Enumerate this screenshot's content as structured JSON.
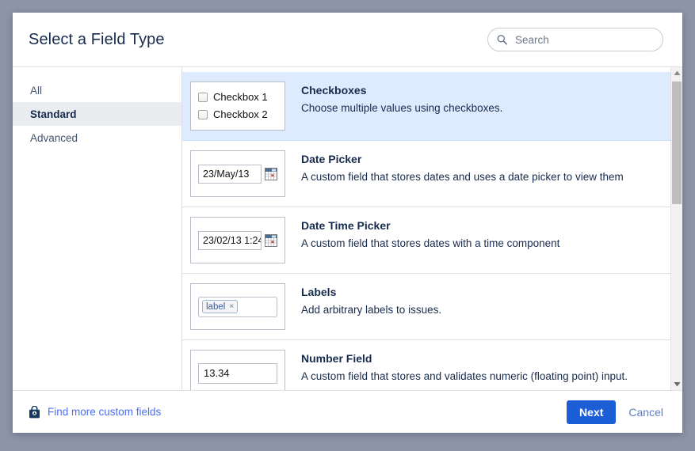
{
  "dialog": {
    "title": "Select a Field Type"
  },
  "search": {
    "placeholder": "Search",
    "value": "",
    "icon": "search-icon"
  },
  "sidebar": {
    "items": [
      {
        "label": "All",
        "selected": false
      },
      {
        "label": "Standard",
        "selected": true
      },
      {
        "label": "Advanced",
        "selected": false
      }
    ]
  },
  "fields": [
    {
      "name": "Checkboxes",
      "description": "Choose multiple values using checkboxes.",
      "selected": true,
      "preview_type": "checkboxes",
      "preview": {
        "option1": "Checkbox 1",
        "option2": "Checkbox 2"
      }
    },
    {
      "name": "Date Picker",
      "description": "A custom field that stores dates and uses a date picker to view them",
      "selected": false,
      "preview_type": "date",
      "preview": {
        "value": "23/May/13",
        "icon": "calendar-icon"
      }
    },
    {
      "name": "Date Time Picker",
      "description": "A custom field that stores dates with a time component",
      "selected": false,
      "preview_type": "date",
      "preview": {
        "value": "23/02/13 1:24",
        "icon": "calendar-icon"
      }
    },
    {
      "name": "Labels",
      "description": "Add arbitrary labels to issues.",
      "selected": false,
      "preview_type": "labels",
      "preview": {
        "chip": "label",
        "remove": "×"
      }
    },
    {
      "name": "Number Field",
      "description": "A custom field that stores and validates numeric (floating point) input.",
      "selected": false,
      "preview_type": "number",
      "preview": {
        "value": "13.34"
      }
    }
  ],
  "footer": {
    "find_more_label": "Find more custom fields",
    "find_more_icon": "marketplace-bag-icon",
    "next_label": "Next",
    "cancel_label": "Cancel"
  },
  "colors": {
    "page_background": "#8d94a6",
    "selected_row": "#deebff",
    "selected_sidebar": "#ebecf0",
    "primary_button": "#1c5ed6",
    "title_text": "#172b4d",
    "link_text": "#4c6ef5"
  }
}
